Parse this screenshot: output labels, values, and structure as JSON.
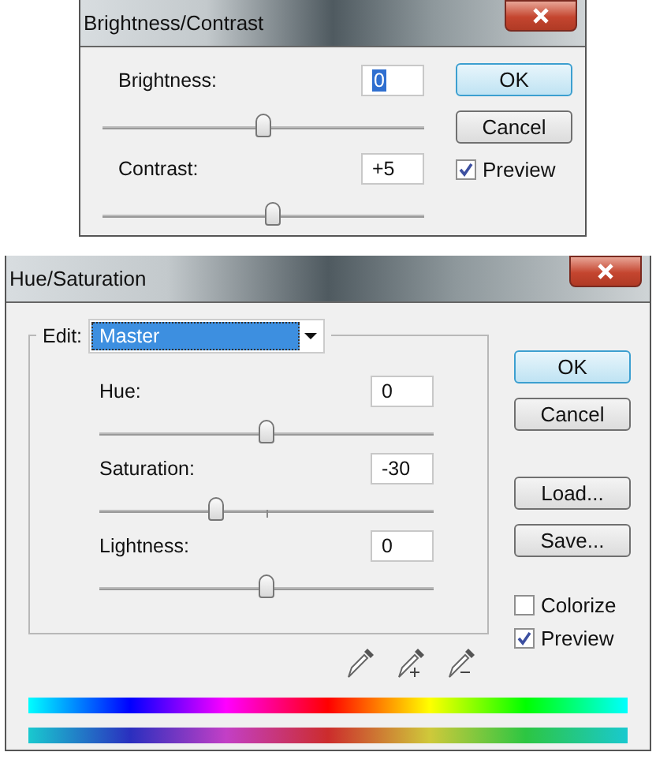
{
  "brightness_contrast": {
    "title": "Brightness/Contrast",
    "sliders": [
      {
        "label": "Brightness:",
        "value": "0",
        "value_selected": true,
        "level": 0.5
      },
      {
        "label": "Contrast:",
        "value": "+5",
        "value_selected": false,
        "level": 0.53
      }
    ],
    "buttons": [
      {
        "label": "OK",
        "default": true
      },
      {
        "label": "Cancel",
        "default": false
      }
    ],
    "checkboxes": [
      {
        "label": "Preview",
        "checked": true
      }
    ]
  },
  "hue_saturation": {
    "title": "Hue/Saturation",
    "edit": {
      "label": "Edit:",
      "value": "Master"
    },
    "sliders": [
      {
        "label": "Hue:",
        "value": "0",
        "value_selected": false,
        "level": 0.5
      },
      {
        "label": "Saturation:",
        "value": "-30",
        "value_selected": false,
        "level": 0.35
      },
      {
        "label": "Lightness:",
        "value": "0",
        "value_selected": false,
        "level": 0.5
      }
    ],
    "buttons": [
      {
        "label": "OK",
        "default": true
      },
      {
        "label": "Cancel",
        "default": false
      }
    ],
    "file_buttons": [
      {
        "label": "Load...",
        "default": false
      },
      {
        "label": "Save...",
        "default": false
      }
    ],
    "checkboxes": [
      {
        "label": "Colorize",
        "checked": false
      },
      {
        "label": "Preview",
        "checked": true
      }
    ]
  }
}
